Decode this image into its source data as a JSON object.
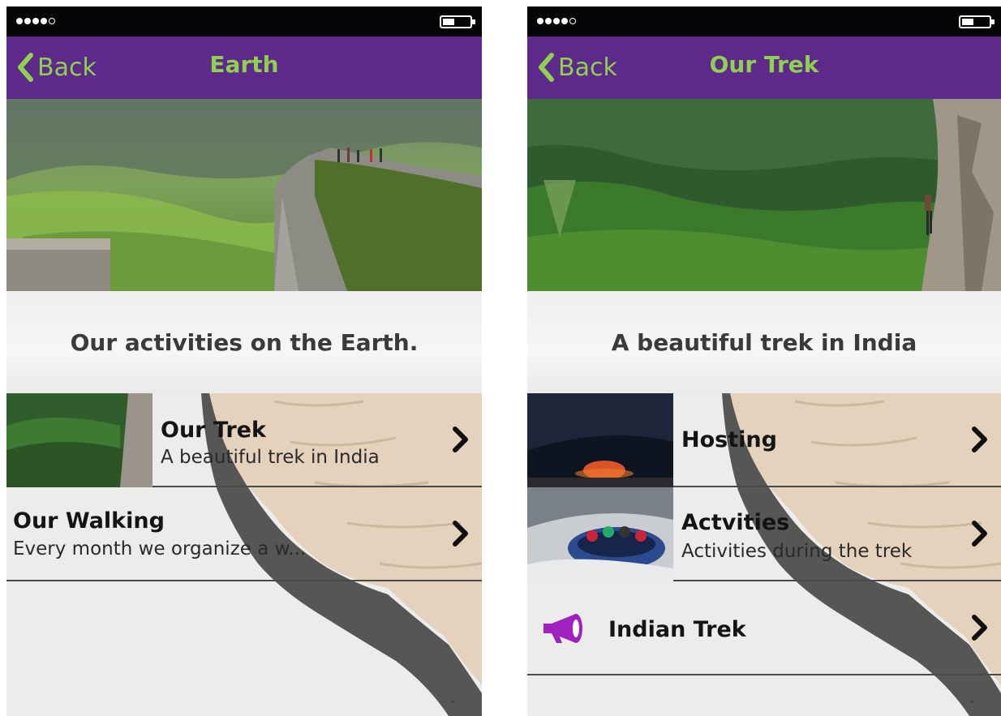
{
  "screens": {
    "left": {
      "status_icons": [
        "signal-dots-icon",
        "battery-icon"
      ],
      "back_label": "Back",
      "title": "Earth",
      "subtitle": "Our activities on the Earth.",
      "items": [
        {
          "title": "Our Trek",
          "subtitle": "A beautiful trek in India",
          "icon": "trek-thumbnail"
        },
        {
          "title": "Our Walking",
          "subtitle": "Every month we organize a w...",
          "icon": ""
        }
      ]
    },
    "right": {
      "status_icons": [
        "signal-dots-icon",
        "battery-icon"
      ],
      "back_label": "Back",
      "title": "Our Trek",
      "subtitle": "A beautiful trek in India",
      "items": [
        {
          "title": "Hosting",
          "subtitle": "",
          "icon": "tent-night-photo"
        },
        {
          "title": "Actvities",
          "subtitle": "Activities during the trek",
          "icon": "rafting-photo"
        },
        {
          "title": "Indian Trek",
          "subtitle": "",
          "icon": "megaphone-icon"
        }
      ]
    }
  },
  "colors": {
    "nav_background": "#5d2a8b",
    "nav_text": "#8fd14f",
    "status_bar": "#050505",
    "megaphone": "#a020c0"
  }
}
